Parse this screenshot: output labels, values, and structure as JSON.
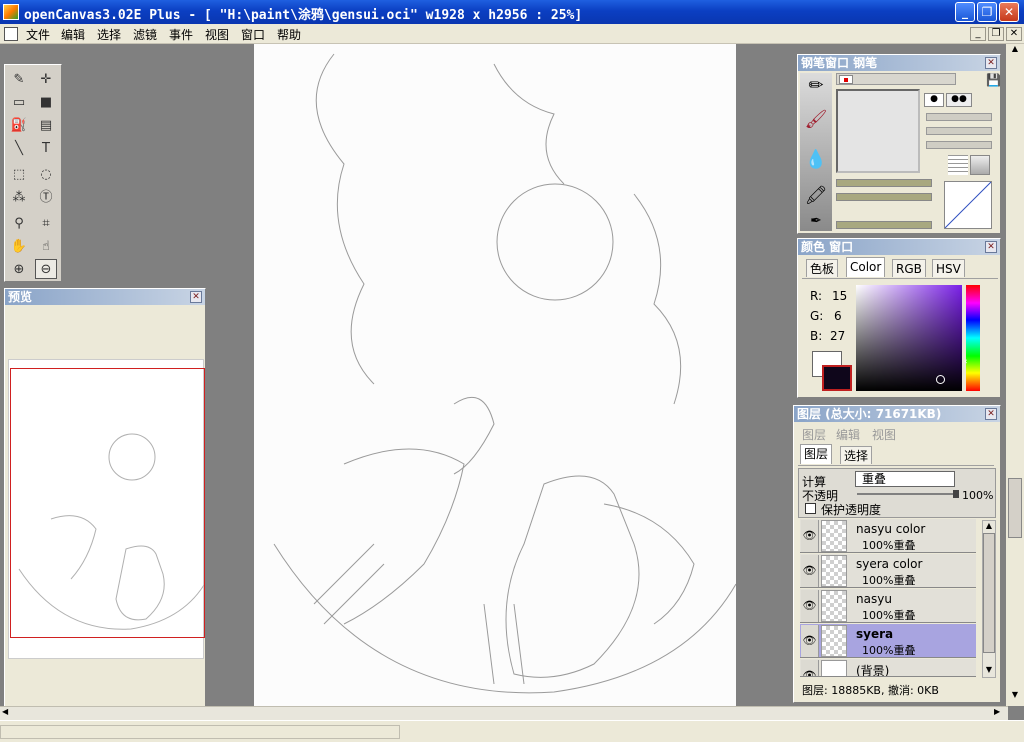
{
  "window": {
    "title": "openCanvas3.02E Plus - [ \"H:\\paint\\涂鸦\\gensui.oci\" w1928 x h2956 : 25%]",
    "minimize": "_",
    "restore": "❐",
    "close": "✕"
  },
  "menu": [
    "文件",
    "编辑",
    "选择",
    "滤镜",
    "事件",
    "视图",
    "窗口",
    "帮助"
  ],
  "mdi": {
    "min": "_",
    "restore": "❐",
    "close": "✕"
  },
  "tools": [
    {
      "name": "pen-tool",
      "glyph": "✎"
    },
    {
      "name": "move-tool",
      "glyph": "✛"
    },
    {
      "name": "rect-tool",
      "glyph": "▭"
    },
    {
      "name": "fill-rect-tool",
      "glyph": "■"
    },
    {
      "name": "bucket-tool",
      "glyph": "⛽"
    },
    {
      "name": "gradient-tool",
      "glyph": "▤"
    },
    {
      "name": "line-tool",
      "glyph": "╲"
    },
    {
      "name": "text-tool",
      "glyph": "T"
    },
    {
      "name": "rect-select-tool",
      "glyph": "⬚"
    },
    {
      "name": "lasso-tool",
      "glyph": "◌"
    },
    {
      "name": "wand-tool",
      "glyph": "⁂"
    },
    {
      "name": "text-select-tool",
      "glyph": "Ⓣ"
    },
    {
      "name": "eyedropper-tool",
      "glyph": "⚲"
    },
    {
      "name": "crop-tool",
      "glyph": "⌗"
    },
    {
      "name": "hand-tool",
      "glyph": "✋"
    },
    {
      "name": "rotate-hand-tool",
      "glyph": "☝"
    },
    {
      "name": "zoom-in-tool",
      "glyph": "⊕"
    },
    {
      "name": "zoom-out-tool",
      "glyph": "⊖"
    }
  ],
  "preview": {
    "title": "预览"
  },
  "pen_window": {
    "title": "钢笔窗口  钢笔"
  },
  "color_window": {
    "title": "颜色  窗口",
    "tabs": [
      "色板",
      "Color",
      "RGB",
      "HSV"
    ],
    "active_tab": "Color",
    "r_label": "R:",
    "r": "15",
    "g_label": "G:",
    "g": "6",
    "b_label": "B:",
    "b": "27",
    "foreground": "#0f061b",
    "background": "#ffffff"
  },
  "layers_window": {
    "title": "图层 (总大小: 71671KB)",
    "menu": [
      "图层",
      "编辑",
      "视图"
    ],
    "tabs": [
      "图层",
      "选择"
    ],
    "blend_label": "计算",
    "blend_value": "重叠",
    "opacity_label": "不透明",
    "opacity_value": "100%",
    "opacity_level": 1.0,
    "protect_label": "保护透明度",
    "layers": [
      {
        "name": "nasyu color",
        "mode": "100%重叠",
        "selected": false
      },
      {
        "name": "syera color",
        "mode": "100%重叠",
        "selected": false
      },
      {
        "name": "nasyu",
        "mode": "100%重叠",
        "selected": false
      },
      {
        "name": "syera",
        "mode": "100%重叠",
        "selected": true
      },
      {
        "name": "(背景)",
        "mode": "",
        "selected": false
      }
    ],
    "footer": "图层: 18885KB, 撤消: 0KB"
  }
}
